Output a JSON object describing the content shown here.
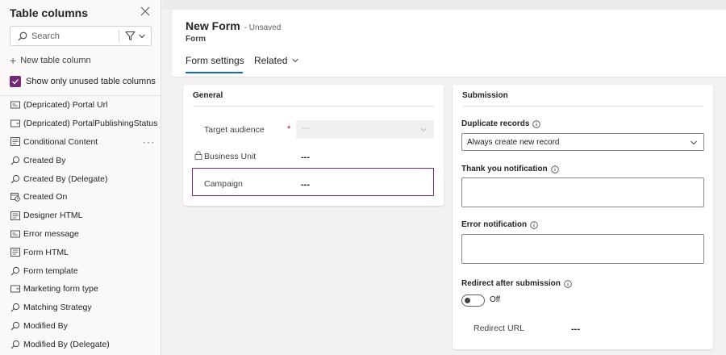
{
  "sidebar": {
    "title": "Table columns",
    "search_placeholder": "Search",
    "new_column_label": "New table column",
    "unused_toggle_label": "Show only unused table columns",
    "columns": [
      {
        "label": "(Depricated) Portal Url",
        "icon": "text-field-icon"
      },
      {
        "label": "(Depricated) PortalPublishingStatus",
        "icon": "option-set-icon"
      },
      {
        "label": "Conditional Content",
        "icon": "multiline-text-icon",
        "more": "···"
      },
      {
        "label": "Created By",
        "icon": "lookup-icon"
      },
      {
        "label": "Created By (Delegate)",
        "icon": "lookup-icon"
      },
      {
        "label": "Created On",
        "icon": "calendar-clock-icon"
      },
      {
        "label": "Designer HTML",
        "icon": "multiline-text-icon"
      },
      {
        "label": "Error message",
        "icon": "text-field-icon"
      },
      {
        "label": "Form HTML",
        "icon": "multiline-text-icon"
      },
      {
        "label": "Form template",
        "icon": "lookup-icon"
      },
      {
        "label": "Marketing form type",
        "icon": "option-set-icon"
      },
      {
        "label": "Matching Strategy",
        "icon": "lookup-icon"
      },
      {
        "label": "Modified By",
        "icon": "lookup-icon"
      },
      {
        "label": "Modified By (Delegate)",
        "icon": "lookup-icon"
      }
    ]
  },
  "header": {
    "title": "New Form",
    "status": "- Unsaved",
    "subtitle": "Form",
    "tabs": [
      {
        "label": "Form settings",
        "active": true
      },
      {
        "label": "Related",
        "active": false
      }
    ]
  },
  "general": {
    "title": "General",
    "target_audience_label": "Target audience",
    "required_mark": "*",
    "target_audience_value": "---",
    "business_unit_label": "Business Unit",
    "business_unit_value": "---",
    "campaign_label": "Campaign",
    "campaign_value": "---"
  },
  "submission": {
    "title": "Submission",
    "duplicate_label": "Duplicate records",
    "duplicate_value": "Always create new record",
    "thank_you_label": "Thank you notification",
    "error_label": "Error notification",
    "redirect_label": "Redirect after submission",
    "redirect_toggle_state": "Off",
    "redirect_url_label": "Redirect URL",
    "redirect_url_value": "---"
  },
  "colors": {
    "accent": "#742774",
    "tab_underline": "#0f6cbd",
    "required": "#c50f1f"
  }
}
